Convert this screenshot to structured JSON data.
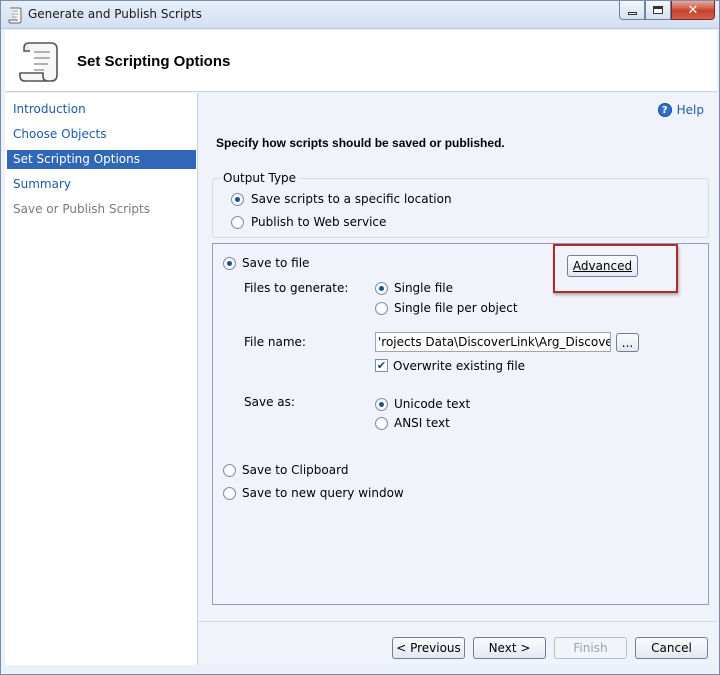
{
  "window": {
    "title": "Generate and Publish Scripts"
  },
  "header": {
    "title": "Set Scripting Options"
  },
  "nav": {
    "items": [
      {
        "label": "Introduction",
        "state": "link"
      },
      {
        "label": "Choose Objects",
        "state": "link"
      },
      {
        "label": "Set Scripting Options",
        "state": "active"
      },
      {
        "label": "Summary",
        "state": "link"
      },
      {
        "label": "Save or Publish Scripts",
        "state": "disabled"
      }
    ]
  },
  "main": {
    "help_label": "Help",
    "instruction": "Specify how scripts should be saved or published.",
    "output_type": {
      "legend": "Output Type",
      "options": [
        {
          "label": "Save scripts to a specific location",
          "selected": true
        },
        {
          "label": "Publish to Web service",
          "selected": false
        }
      ]
    },
    "save_to_file": {
      "label": "Save to file",
      "selected": true,
      "advanced_label": "Advanced",
      "files_to_generate_label": "Files to generate:",
      "files_options": [
        {
          "label": "Single file",
          "selected": true
        },
        {
          "label": "Single file per object",
          "selected": false
        }
      ],
      "file_name_label": "File name:",
      "file_name_value": "'rojects Data\\DiscoverLink\\Arg_DiscoverLink.sql",
      "browse_label": "...",
      "overwrite_label": "Overwrite existing file",
      "overwrite_checked": true,
      "save_as_label": "Save as:",
      "save_as_options": [
        {
          "label": "Unicode text",
          "selected": true
        },
        {
          "label": "ANSI text",
          "selected": false
        }
      ]
    },
    "save_to_clipboard": {
      "label": "Save to Clipboard",
      "selected": false
    },
    "save_to_query_window": {
      "label": "Save to new query window",
      "selected": false
    }
  },
  "footer": {
    "previous_label": "< Previous",
    "next_label": "Next >",
    "finish_label": "Finish",
    "cancel_label": "Cancel"
  },
  "colors": {
    "accent": "#3067b6",
    "link": "#1d5aa8",
    "highlight_border": "#b3272d"
  },
  "icons": [
    "scroll-icon",
    "help-icon",
    "minimize-icon",
    "maximize-icon",
    "close-icon"
  ]
}
